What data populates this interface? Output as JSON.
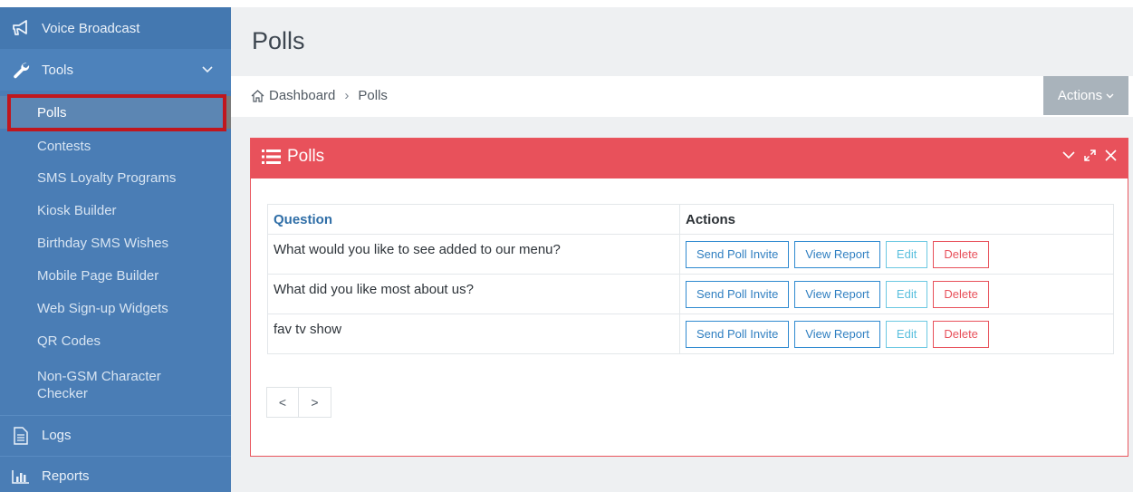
{
  "sidebar": {
    "voice_broadcast": "Voice Broadcast",
    "tools": "Tools",
    "sub_items": [
      "Polls",
      "Contests",
      "SMS Loyalty Programs",
      "Kiosk Builder",
      "Birthday SMS Wishes",
      "Mobile Page Builder",
      "Web Sign-up Widgets",
      "QR Codes",
      "Non-GSM Character Checker"
    ],
    "logs": "Logs",
    "reports": "Reports"
  },
  "header": {
    "page_title": "Polls",
    "breadcrumb_home": "Dashboard",
    "breadcrumb_current": "Polls",
    "actions": "Actions"
  },
  "panel": {
    "title": "Polls",
    "col_question": "Question",
    "col_actions": "Actions",
    "rows": [
      {
        "question": "What would you like to see added to our menu?"
      },
      {
        "question": "What did you like most about us?"
      },
      {
        "question": "fav tv show"
      }
    ],
    "buttons": {
      "send": "Send Poll Invite",
      "view": "View Report",
      "edit": "Edit",
      "delete": "Delete"
    },
    "pager": {
      "prev": "<",
      "next": ">"
    }
  },
  "colors": {
    "sidebar": "#4a7db5",
    "panel_header": "#e8515b",
    "highlight": "#c0161d"
  }
}
